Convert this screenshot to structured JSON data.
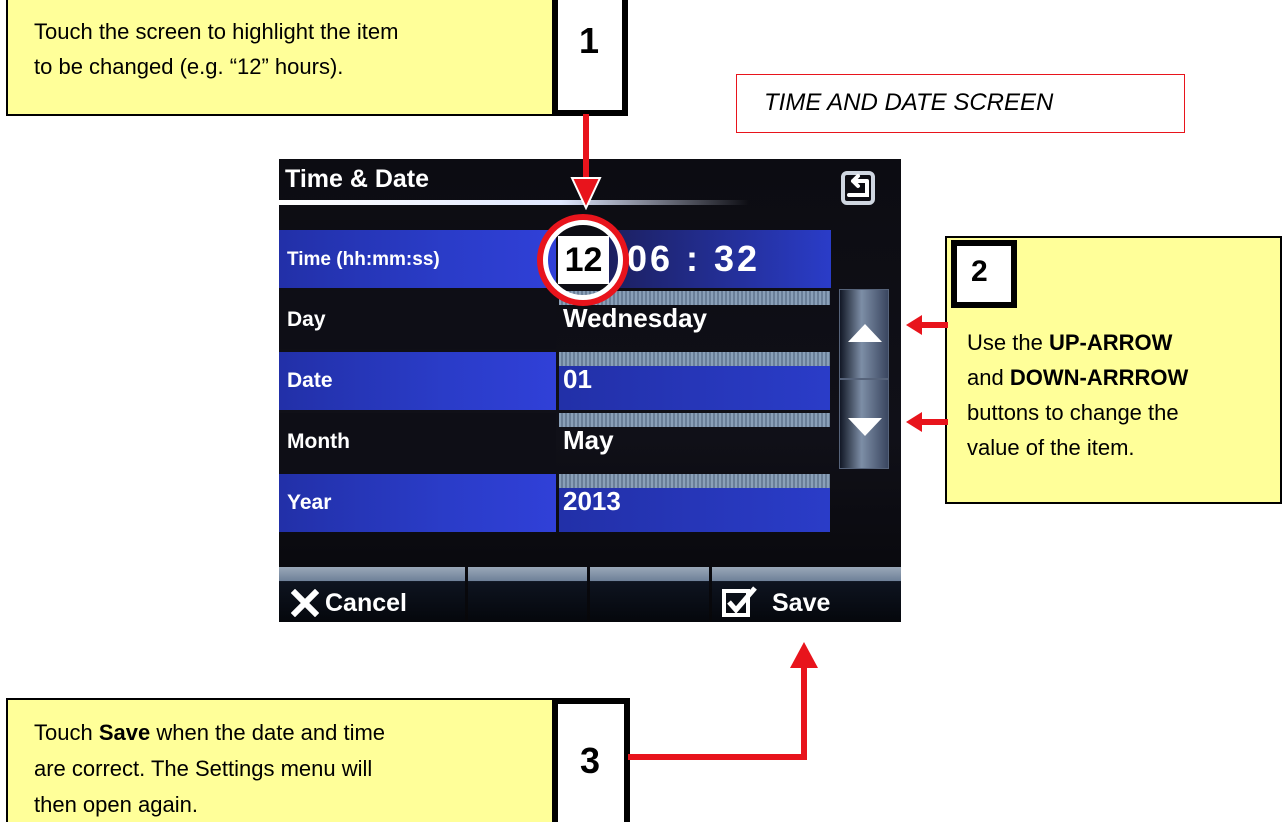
{
  "callout1": {
    "number": "1",
    "line1": "Touch the screen to highlight the item",
    "line2": "to be changed  (e.g. “12” hours)."
  },
  "screen_title_label": "TIME AND DATE SCREEN",
  "device": {
    "title": "Time & Date",
    "back_icon": "return-arrow-icon",
    "rows": [
      {
        "label": "Time (hh:mm:ss)",
        "hours": "12",
        "rest": "06 : 32"
      },
      {
        "label": "Day",
        "value": "Wednesday"
      },
      {
        "label": "Date",
        "value": "01"
      },
      {
        "label": "Month",
        "value": "May"
      },
      {
        "label": "Year",
        "value": "2013"
      }
    ],
    "cancel_label": "Cancel",
    "save_label": "Save",
    "up_icon": "up-arrow-icon",
    "down_icon": "down-arrow-icon"
  },
  "callout2": {
    "number": "2",
    "t1": "Use the ",
    "b1": "UP-ARROW",
    "t2": "and ",
    "b2": "DOWN-ARRROW",
    "t3": "buttons to change the",
    "t4": "value of the item."
  },
  "callout3": {
    "number": "3",
    "t1": "Touch ",
    "b1": "Save",
    "t2": " when the date and time",
    "t3": "are correct. The Settings menu will",
    "t4": "then open again."
  },
  "colors": {
    "callout_bg": "#ffff99",
    "annotation_red": "#e8141c",
    "highlight_blue": "#2a3cc8"
  }
}
